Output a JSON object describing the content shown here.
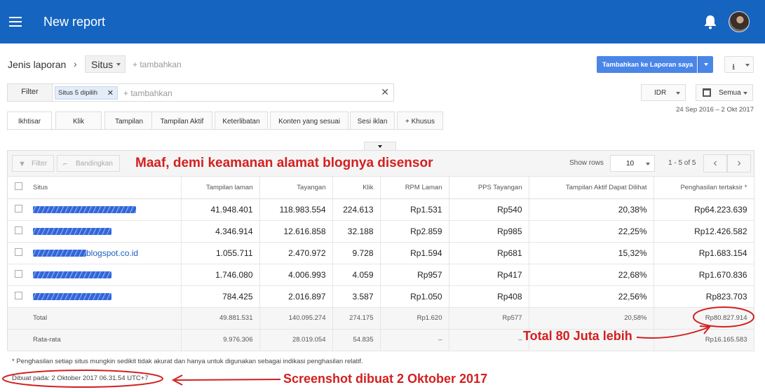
{
  "header": {
    "title": "New report",
    "colors": {
      "appbar": "#1565c0"
    }
  },
  "report_type": {
    "label": "Jenis laporan",
    "selected": "Situs",
    "add": "+ tambahkan"
  },
  "actions": {
    "add_to_reports": "Tambahkan ke Laporan saya"
  },
  "filter": {
    "label": "Filter",
    "chip": "Situs 5 dipilih",
    "add": "+ tambahkan"
  },
  "currency": "IDR",
  "date": {
    "button": "Semua",
    "range": "24 Sep 2016 – 2 Okt 2017"
  },
  "tabs": [
    "Ikhtisar",
    "Klik",
    "Tampilan",
    "Tampilan Aktif",
    "Keterlibatan",
    "Konten yang sesuai",
    "Sesi iklan",
    "+ Khusus"
  ],
  "toolbar": {
    "filter": "Filter",
    "compare": "Bandingkan",
    "show_rows_label": "Show rows",
    "rows": "10",
    "page_count": "1 - 5 of 5"
  },
  "annotations": {
    "censor_note": "Maaf, demi keamanan alamat blognya disensor",
    "total_note": "Total 80 Juta lebih",
    "screenshot_note": "Screenshot dibuat 2 Oktober 2017"
  },
  "table": {
    "columns": [
      "Situs",
      "Tampilan laman",
      "Tayangan",
      "Klik",
      "RPM Laman",
      "PPS Tayangan",
      "Tampilan Aktif Dapat Dilihat",
      "Penghasilan tertaksir *"
    ],
    "rows": [
      {
        "site_visible": "",
        "values": [
          "41.948.401",
          "118.983.554",
          "224.613",
          "Rp1.531",
          "Rp540",
          "20,38%",
          "Rp64.223.639"
        ]
      },
      {
        "site_visible": "",
        "values": [
          "4.346.914",
          "12.616.858",
          "32.188",
          "Rp2.859",
          "Rp985",
          "22,25%",
          "Rp12.426.582"
        ]
      },
      {
        "site_visible": "blogspot.co.id",
        "values": [
          "1.055.711",
          "2.470.972",
          "9.728",
          "Rp1.594",
          "Rp681",
          "15,32%",
          "Rp1.683.154"
        ]
      },
      {
        "site_visible": "",
        "values": [
          "1.746.080",
          "4.006.993",
          "4.059",
          "Rp957",
          "Rp417",
          "22,68%",
          "Rp1.670.836"
        ]
      },
      {
        "site_visible": "",
        "values": [
          "784.425",
          "2.016.897",
          "3.587",
          "Rp1.050",
          "Rp408",
          "22,56%",
          "Rp823.703"
        ]
      }
    ],
    "total": {
      "label": "Total",
      "values": [
        "49.881.531",
        "140.095.274",
        "274.175",
        "Rp1.620",
        "Rp577",
        "20,58%",
        "Rp80.827.914"
      ]
    },
    "average": {
      "label": "Rata-rata",
      "values": [
        "9.976.306",
        "28.019.054",
        "54.835",
        "–",
        "–",
        "",
        "Rp16.165.583"
      ]
    }
  },
  "footnote": "* Penghasilan setiap situs mungkin sedikit tidak akurat dan hanya untuk digunakan sebagai indikasi penghasilan relatif.",
  "created_at": "Dibuat pada: 2 Oktober 2017 06.31.54 UTC+7"
}
